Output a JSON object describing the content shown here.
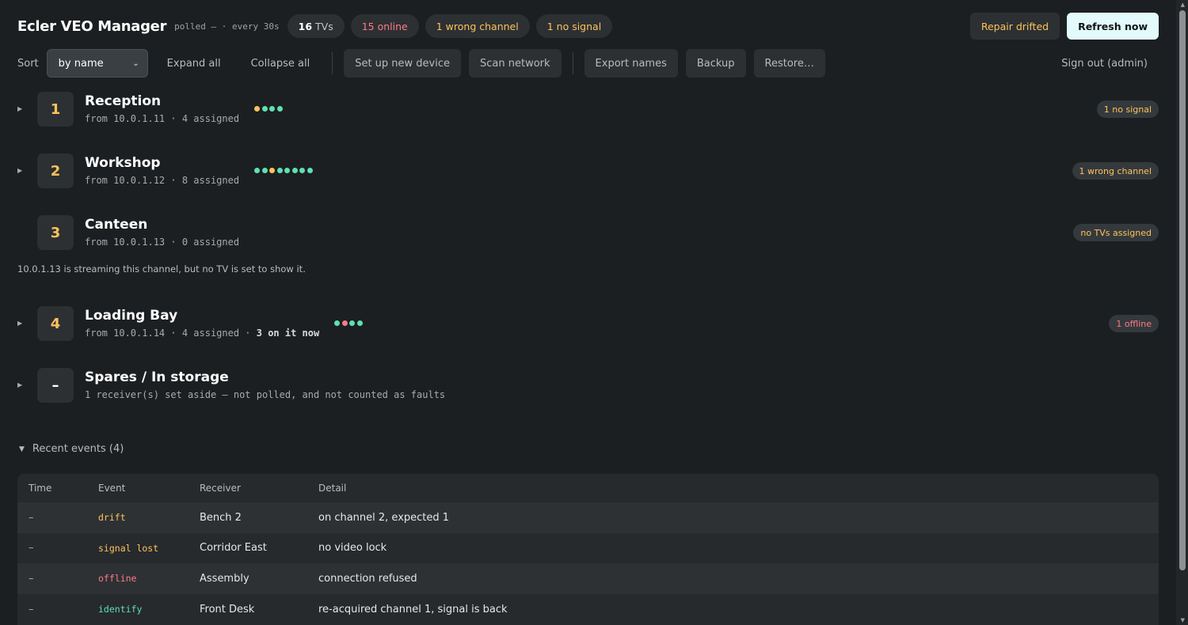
{
  "header": {
    "title": "Ecler VEO Manager",
    "polled": "polled – · every 30s",
    "chips": {
      "tvs_count": "16",
      "tvs_label": "TVs",
      "online": "15 online",
      "wrong_channel": "1 wrong channel",
      "no_signal": "1 no signal"
    },
    "repair_label": "Repair drifted",
    "refresh_label": "Refresh now"
  },
  "toolbar": {
    "sort_label": "Sort",
    "sort_value": "by name",
    "expand_all": "Expand all",
    "collapse_all": "Collapse all",
    "setup_device": "Set up new device",
    "scan_network": "Scan network",
    "export_names": "Export names",
    "backup": "Backup",
    "restore": "Restore…",
    "sign_out": "Sign out (admin)"
  },
  "channels": [
    {
      "number": "1",
      "name": "Reception",
      "sub": "from 10.0.1.11 · 4 assigned",
      "badge": "1 no signal",
      "dots": [
        "amber",
        "green",
        "green",
        "green"
      ]
    },
    {
      "number": "2",
      "name": "Workshop",
      "sub": "from 10.0.1.12 · 8 assigned",
      "badge": "1 wrong channel",
      "dots": [
        "green",
        "green",
        "amber",
        "green",
        "green",
        "green",
        "green",
        "green"
      ]
    },
    {
      "number": "3",
      "name": "Canteen",
      "sub": "from 10.0.1.13 · 0 assigned",
      "badge": "no TVs assigned",
      "note": "10.0.1.13 is streaming this channel, but no TV is set to show it."
    },
    {
      "number": "4",
      "name": "Loading Bay",
      "sub": "from 10.0.1.14 · 4 assigned · ",
      "sub_bold": "3 on it now",
      "badge": "1 offline",
      "dots": [
        "green",
        "red",
        "green",
        "green"
      ]
    },
    {
      "number": "–",
      "name": "Spares / In storage",
      "sub": "1 receiver(s) set aside — not polled, and not counted as faults"
    }
  ],
  "events": {
    "toggle_label": "Recent events (4)",
    "columns": [
      "Time",
      "Event",
      "Receiver",
      "Detail"
    ],
    "rows": [
      {
        "time": "–",
        "event": "drift",
        "receiver": "Bench 2",
        "detail": "on channel 2, expected 1"
      },
      {
        "time": "–",
        "event": "signal lost",
        "receiver": "Corridor East",
        "detail": "no video lock"
      },
      {
        "time": "–",
        "event": "offline",
        "receiver": "Assembly",
        "detail": "connection refused"
      },
      {
        "time": "–",
        "event": "identify",
        "receiver": "Front Desk",
        "detail": "re-acquired channel 1, signal is back"
      }
    ]
  },
  "colors": {
    "background": "#1c1f21",
    "accent_amber": "#ffc25a",
    "accent_red": "#ff7a86",
    "accent_green": "#5fe0b0",
    "refresh_button": "#e2fafb"
  },
  "icons": {
    "row_caret": "triangle-right-icon",
    "events_caret": "triangle-down-icon",
    "sort_dropdown": "chevron-down-icon"
  }
}
